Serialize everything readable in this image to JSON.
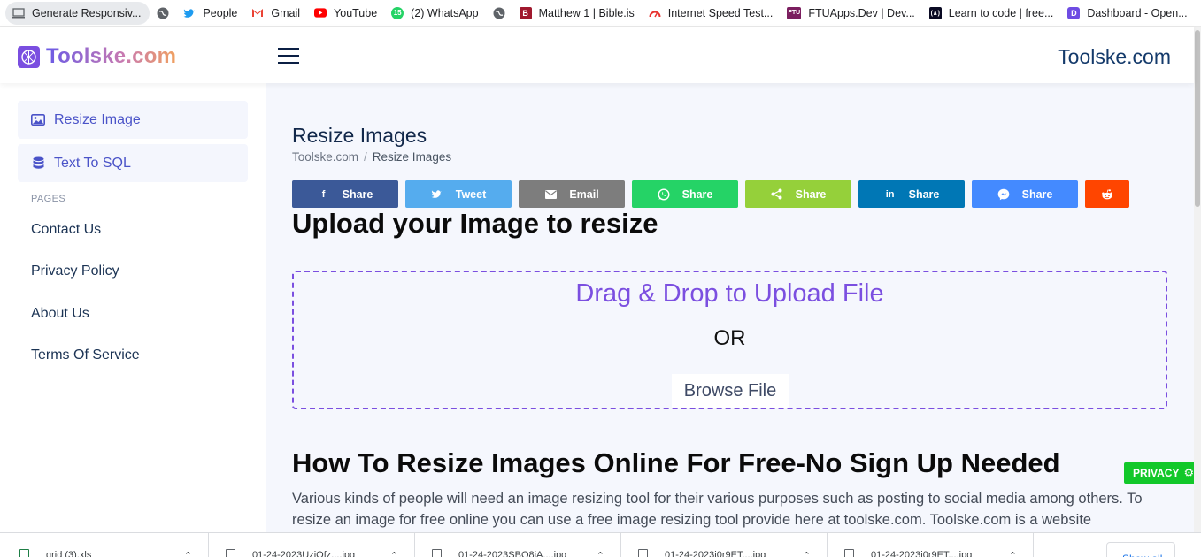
{
  "bookmarks": [
    {
      "label": "Generate Responsiv...",
      "icon": "monitor-icon"
    },
    {
      "label": "",
      "icon": "globe-icon"
    },
    {
      "label": "People",
      "icon": "twitter-icon"
    },
    {
      "label": "Gmail",
      "icon": "gmail-icon"
    },
    {
      "label": "YouTube",
      "icon": "youtube-icon"
    },
    {
      "label": "(2) WhatsApp",
      "icon": "whatsapp-icon",
      "badge": "15"
    },
    {
      "label": "",
      "icon": "globe-icon"
    },
    {
      "label": "Matthew 1 | Bible.is",
      "icon": "bible-icon",
      "glyph": "B"
    },
    {
      "label": "Internet Speed Test...",
      "icon": "speedtest-icon"
    },
    {
      "label": "FTUApps.Dev | Dev...",
      "icon": "ftu-icon",
      "glyph": "FTU"
    },
    {
      "label": "Learn to code | free...",
      "icon": "freecodecamp-icon",
      "glyph": "(∧)"
    },
    {
      "label": "Dashboard - Open...",
      "icon": "dashboard-icon",
      "glyph": "D"
    }
  ],
  "header": {
    "logo_text": "Toolske.com",
    "site_name": "Toolske.com"
  },
  "sidebar": {
    "items": [
      {
        "label": "Resize Image",
        "icon": "image-icon"
      },
      {
        "label": "Text To SQL",
        "icon": "database-icon"
      }
    ],
    "section_label": "PAGES",
    "links": [
      "Contact Us",
      "Privacy Policy",
      "About Us",
      "Terms Of Service"
    ]
  },
  "main": {
    "page_title": "Resize Images",
    "breadcrumb": {
      "home": "Toolske.com",
      "separator": "/",
      "current": "Resize Images"
    },
    "share_buttons": [
      {
        "label": "Share",
        "network": "facebook",
        "color": "#3b5998",
        "icon": "facebook-icon",
        "glyph": "f"
      },
      {
        "label": "Tweet",
        "network": "twitter",
        "color": "#55acee",
        "icon": "twitter-icon",
        "glyph": "✦"
      },
      {
        "label": "Email",
        "network": "email",
        "color": "#7d7d7d",
        "icon": "email-icon",
        "glyph": "✉"
      },
      {
        "label": "Share",
        "network": "whatsapp",
        "color": "#25d366",
        "icon": "whatsapp-icon",
        "glyph": "✆"
      },
      {
        "label": "Share",
        "network": "sharethis",
        "color": "#95d03a",
        "icon": "share-icon",
        "glyph": "⋖"
      },
      {
        "label": "Share",
        "network": "linkedin",
        "color": "#0077b5",
        "icon": "linkedin-icon",
        "glyph": "in"
      },
      {
        "label": "Share",
        "network": "messenger",
        "color": "#448aff",
        "icon": "messenger-icon",
        "glyph": "ϟ"
      },
      {
        "label": "",
        "network": "reddit",
        "color": "#ff4500",
        "icon": "reddit-icon",
        "glyph": "●"
      }
    ],
    "upload_heading": "Upload your Image to resize",
    "dropzone": {
      "title": "Drag & Drop to Upload File",
      "or_text": "OR",
      "browse_label": "Browse File"
    },
    "how_heading": "How To Resize Images Online For Free-No Sign Up Needed",
    "paragraph": "Various kinds of people will need an image resizing tool for their various purposes such as posting to social media among others. To resize an image for free online you can use a free image resizing tool provide here at toolske.com. Toolske.com is a website"
  },
  "privacy_badge": "PRIVACY",
  "downloads": {
    "items": [
      {
        "name": "grid (3).xls",
        "type": "xls"
      },
      {
        "name": "01-24-2023UziOfz....jpg",
        "type": "jpg"
      },
      {
        "name": "01-24-2023SBO8iA....jpg",
        "type": "jpg"
      },
      {
        "name": "01-24-2023i0r9ET....jpg",
        "type": "jpg"
      },
      {
        "name": "01-24-2023i0r9ET....jpg",
        "type": "jpg"
      }
    ],
    "show_all": "Show all"
  },
  "colors": {
    "accent": "#7b4fe0",
    "sidebar_text": "#4a53c8",
    "privacy_green": "#12c82a"
  }
}
